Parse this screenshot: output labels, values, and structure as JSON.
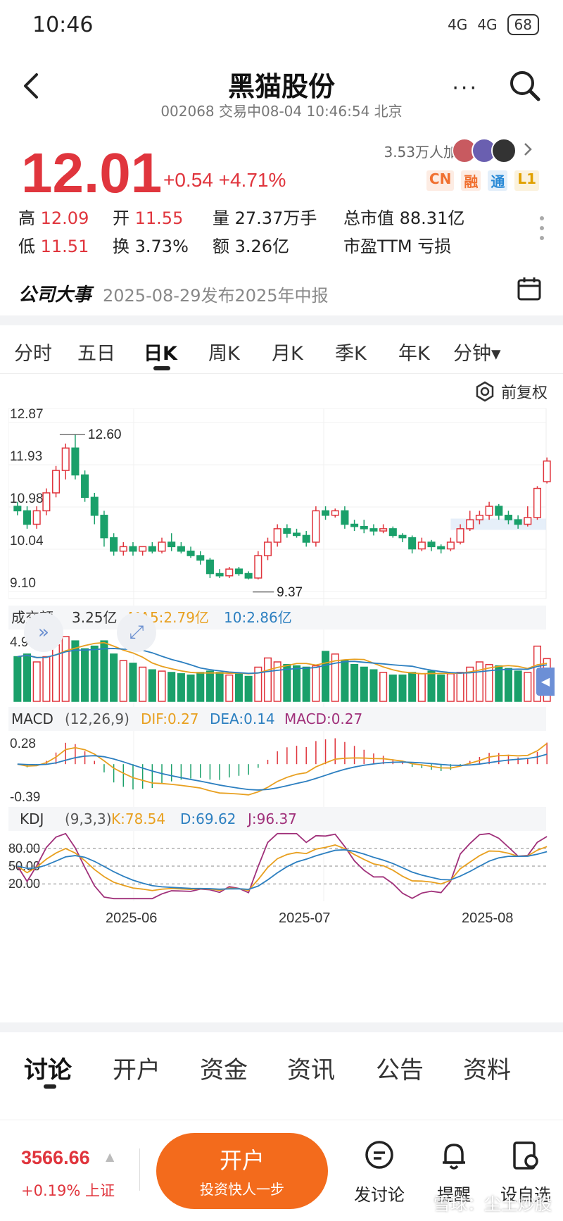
{
  "status": {
    "time": "10:46",
    "network1": "4G",
    "network2": "4G",
    "battery": "68"
  },
  "header": {
    "title": "黑猫股份",
    "subtitle": "002068 交易中08-04 10:46:54 北京",
    "more": "···"
  },
  "quote": {
    "price": "12.01",
    "change": "+0.54 +4.71%",
    "followers": "3.53万人加自选",
    "badges": [
      {
        "text": "CN",
        "color": "#f07030"
      },
      {
        "text": "融",
        "color": "#f07030"
      },
      {
        "text": "通",
        "color": "#2a8ad6"
      },
      {
        "text": "L1",
        "color": "#e0a000"
      }
    ],
    "stats": {
      "high_label": "高",
      "high": "12.09",
      "open_label": "开",
      "open": "11.55",
      "vol_label": "量",
      "vol": "27.37万手",
      "mcap_label": "总市值",
      "mcap": "88.31亿",
      "low_label": "低",
      "low": "11.51",
      "turn_label": "换",
      "turn": "3.73%",
      "amt_label": "额",
      "amt": "3.26亿",
      "pe_label": "市盈TTM",
      "pe": "亏损"
    }
  },
  "events": {
    "label": "公司大事",
    "text": "2025-08-29发布2025年中报"
  },
  "ktabs": [
    "分时",
    "五日",
    "日K",
    "周K",
    "月K",
    "季K",
    "年K",
    "分钟▾"
  ],
  "ktab_active": 2,
  "adjust_label": "前复权",
  "colors": {
    "up": "#e0353d",
    "down": "#1aa06a",
    "ma5": "#e8a020",
    "ma10": "#2c7fc0",
    "k": "#e8a020",
    "d": "#2c7fc0",
    "j": "#a0307a"
  },
  "chart_data": {
    "type": "candlestick",
    "y_ticks": [
      "12.87",
      "11.93",
      "10.98",
      "10.04",
      "9.10"
    ],
    "ylim": [
      9.1,
      12.87
    ],
    "max_label": "12.60",
    "min_label": "9.37",
    "x_ticks": [
      "2025-06",
      "2025-07",
      "2025-08"
    ],
    "candles": [
      [
        11.0,
        10.9,
        11.1,
        10.8
      ],
      [
        10.9,
        10.6,
        11.0,
        10.5
      ],
      [
        10.6,
        10.9,
        11.0,
        10.5
      ],
      [
        10.9,
        11.3,
        11.4,
        10.8
      ],
      [
        11.3,
        11.8,
        11.9,
        11.2
      ],
      [
        11.8,
        12.3,
        12.4,
        11.6
      ],
      [
        12.3,
        11.7,
        12.6,
        11.6
      ],
      [
        11.7,
        11.2,
        11.8,
        11.1
      ],
      [
        11.2,
        10.8,
        11.3,
        10.6
      ],
      [
        10.8,
        10.3,
        10.9,
        10.1
      ],
      [
        10.3,
        10.0,
        10.4,
        9.9
      ],
      [
        10.0,
        10.1,
        10.2,
        9.9
      ],
      [
        10.1,
        10.0,
        10.2,
        9.9
      ],
      [
        10.0,
        10.1,
        10.1,
        9.9
      ],
      [
        10.1,
        10.0,
        10.2,
        9.95
      ],
      [
        10.0,
        10.2,
        10.3,
        9.95
      ],
      [
        10.2,
        10.1,
        10.4,
        10.0
      ],
      [
        10.1,
        10.0,
        10.2,
        9.95
      ],
      [
        10.0,
        9.9,
        10.1,
        9.85
      ],
      [
        9.9,
        9.8,
        10.0,
        9.7
      ],
      [
        9.8,
        9.5,
        9.85,
        9.4
      ],
      [
        9.5,
        9.45,
        9.6,
        9.4
      ],
      [
        9.45,
        9.6,
        9.65,
        9.4
      ],
      [
        9.6,
        9.5,
        9.65,
        9.45
      ],
      [
        9.5,
        9.4,
        9.55,
        9.37
      ],
      [
        9.4,
        9.9,
        10.0,
        9.37
      ],
      [
        9.9,
        10.2,
        10.3,
        9.8
      ],
      [
        10.2,
        10.5,
        10.6,
        10.1
      ],
      [
        10.5,
        10.4,
        10.6,
        10.3
      ],
      [
        10.4,
        10.35,
        10.5,
        10.3
      ],
      [
        10.35,
        10.2,
        10.45,
        10.1
      ],
      [
        10.2,
        10.9,
        11.0,
        10.1
      ],
      [
        10.9,
        10.8,
        11.0,
        10.7
      ],
      [
        10.8,
        10.9,
        10.95,
        10.75
      ],
      [
        10.9,
        10.6,
        11.0,
        10.5
      ],
      [
        10.6,
        10.55,
        10.7,
        10.45
      ],
      [
        10.55,
        10.5,
        10.7,
        10.4
      ],
      [
        10.5,
        10.45,
        10.6,
        10.35
      ],
      [
        10.45,
        10.5,
        10.6,
        10.4
      ],
      [
        10.5,
        10.35,
        10.55,
        10.3
      ],
      [
        10.35,
        10.3,
        10.4,
        10.2
      ],
      [
        10.3,
        10.05,
        10.35,
        9.95
      ],
      [
        10.05,
        10.2,
        10.3,
        10.0
      ],
      [
        10.2,
        10.1,
        10.25,
        10.0
      ],
      [
        10.1,
        10.05,
        10.15,
        9.95
      ],
      [
        10.05,
        10.2,
        10.3,
        10.0
      ],
      [
        10.2,
        10.5,
        10.6,
        10.15
      ],
      [
        10.5,
        10.7,
        10.9,
        10.45
      ],
      [
        10.7,
        10.8,
        10.9,
        10.6
      ],
      [
        10.8,
        11.0,
        11.1,
        10.7
      ],
      [
        11.0,
        10.8,
        11.05,
        10.7
      ],
      [
        10.8,
        10.7,
        10.9,
        10.6
      ],
      [
        10.7,
        10.6,
        10.8,
        10.5
      ],
      [
        10.6,
        10.75,
        11.0,
        10.55
      ],
      [
        10.75,
        11.4,
        11.45,
        10.7
      ],
      [
        11.55,
        12.01,
        12.09,
        11.51
      ]
    ],
    "volume": {
      "label": "成交额",
      "value": "3.25亿",
      "ma5": "MA5:2.79亿",
      "ma10": "10:2.86亿",
      "max_label": "4.93亿",
      "values": [
        3.4,
        3.6,
        3.0,
        3.4,
        4.3,
        4.93,
        4.6,
        4.0,
        4.2,
        4.6,
        3.6,
        3.1,
        2.9,
        2.6,
        2.4,
        2.3,
        2.2,
        2.1,
        2.0,
        2.2,
        2.3,
        2.2,
        2.0,
        2.1,
        1.9,
        2.6,
        3.3,
        3.0,
        2.8,
        2.7,
        2.6,
        2.7,
        3.8,
        3.6,
        3.1,
        2.8,
        2.6,
        2.4,
        2.2,
        2.0,
        2.0,
        2.2,
        2.1,
        2.3,
        2.0,
        2.1,
        2.2,
        2.6,
        3.0,
        2.8,
        2.7,
        2.5,
        2.3,
        2.2,
        4.2,
        3.25
      ]
    },
    "macd": {
      "label": "MACD",
      "params": "(12,26,9)",
      "dif": "DIF:0.27",
      "dea": "DEA:0.14",
      "macd": "MACD:0.27",
      "top": "0.28",
      "bottom": "-0.39"
    },
    "kdj": {
      "label": "KDJ",
      "params": "(9,3,3)",
      "k": "K:78.54",
      "d": "D:69.62",
      "j": "J:96.37",
      "levels": [
        "80.00",
        "50.00",
        "20.00"
      ]
    }
  },
  "bottom_tabs": [
    "讨论",
    "开户",
    "资金",
    "资讯",
    "公告",
    "资料"
  ],
  "bottom_bar": {
    "index_value": "3566.66",
    "index_change": "+0.19% 上证",
    "open_main": "开户",
    "open_sub": "投资快人一步",
    "actions": [
      "发讨论",
      "提醒",
      "设自选"
    ]
  },
  "watermark": "雪球：尘土炒股"
}
